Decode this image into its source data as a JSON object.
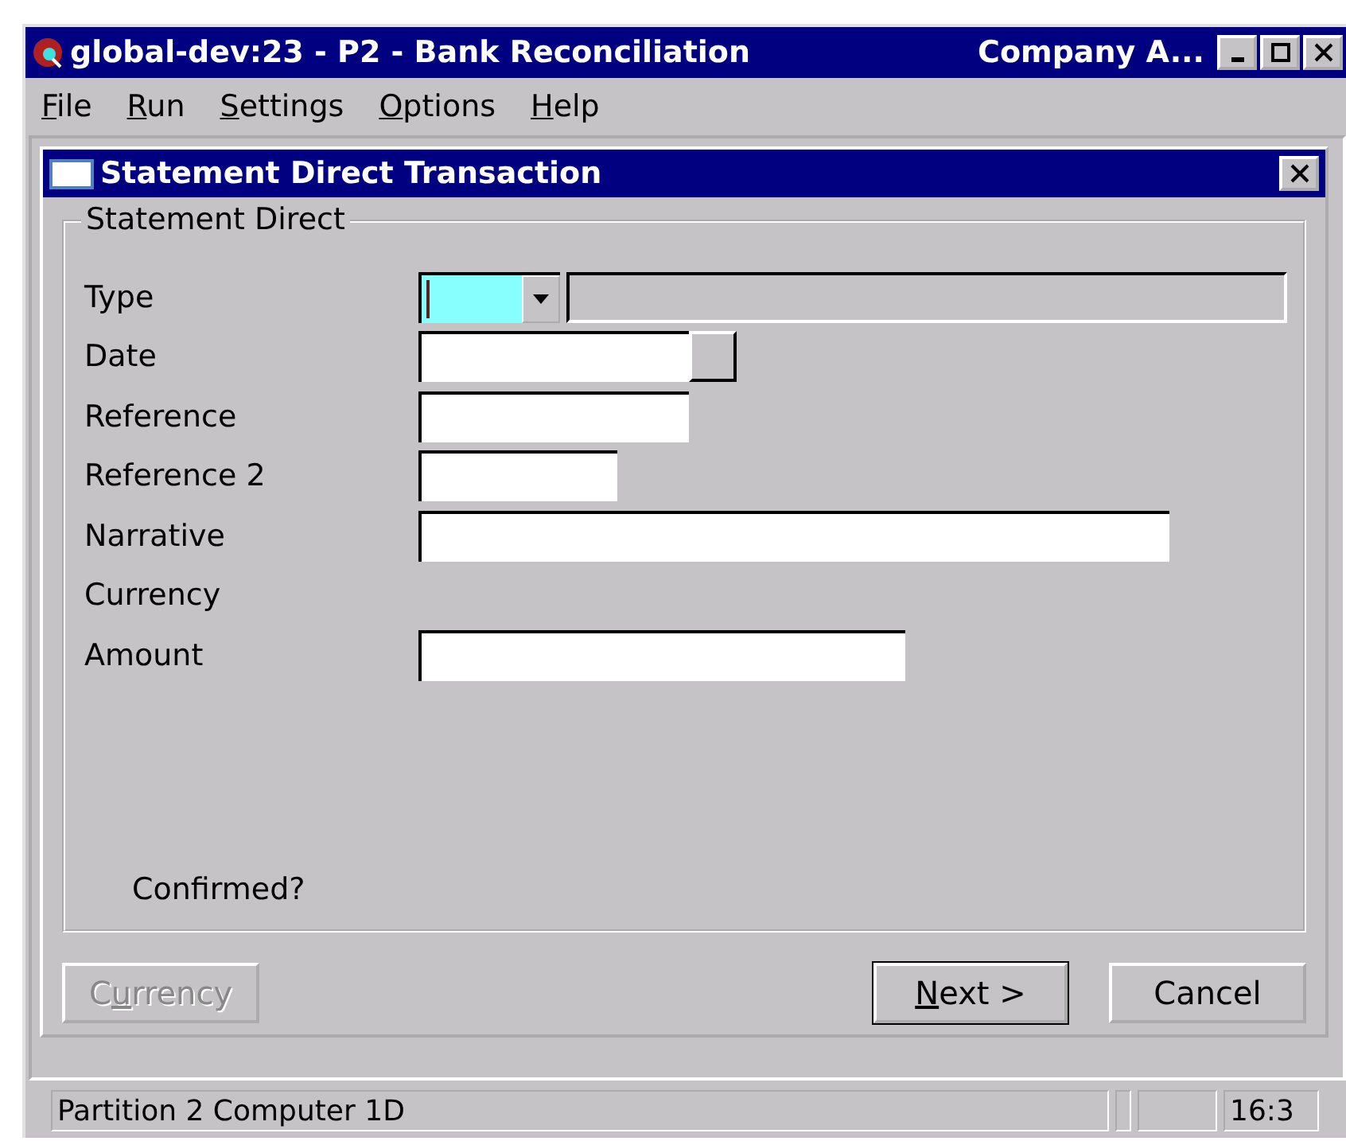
{
  "window": {
    "title": "global-dev:23 - P2 - Bank Reconciliation",
    "company": "Company A..."
  },
  "menu": [
    {
      "key": "F",
      "rest": "ile"
    },
    {
      "key": "R",
      "rest": "un"
    },
    {
      "key": "S",
      "rest": "ettings"
    },
    {
      "key": "O",
      "rest": "ptions"
    },
    {
      "key": "H",
      "rest": "elp"
    }
  ],
  "dialog": {
    "title": "Statement Direct Transaction",
    "group": "Statement Direct",
    "fields": [
      {
        "label": "Type",
        "kind": "combo",
        "focused": true
      },
      {
        "label": "Date",
        "kind": "date"
      },
      {
        "label": "Reference",
        "kind": "medium"
      },
      {
        "label": "Reference 2",
        "kind": "short"
      },
      {
        "label": "Narrative",
        "kind": "wide"
      },
      {
        "label": "Currency",
        "kind": "none"
      },
      {
        "label": "Amount",
        "kind": "amount"
      }
    ],
    "confirm": "Confirmed?",
    "buttons": [
      {
        "pre": "C",
        "key": "u",
        "rest": "rrency",
        "disabled": true,
        "default": false
      },
      {
        "key": "N",
        "rest": "ext >",
        "disabled": false,
        "default": true
      },
      {
        "rest": "Cancel",
        "disabled": false,
        "default": false
      }
    ]
  },
  "status_bar": {
    "text": "Partition 2 Computer 1D",
    "time": "16:3"
  }
}
